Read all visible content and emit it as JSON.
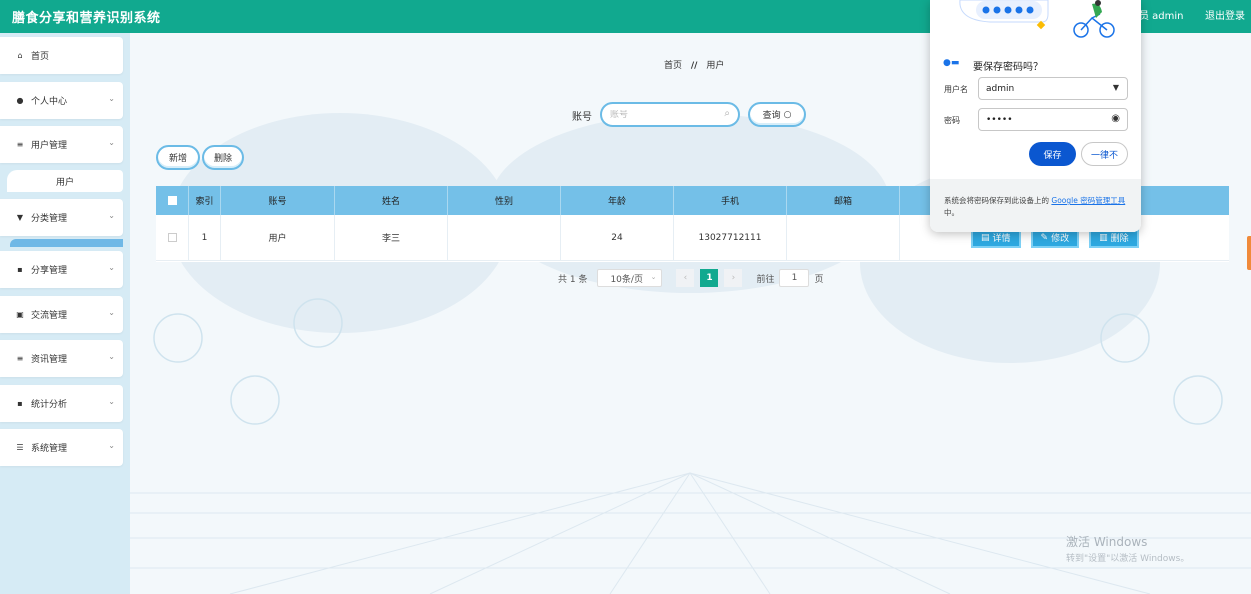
{
  "header": {
    "title": "膳食分享和营养识别系统",
    "user": "员 admin",
    "logout": "退出登录"
  },
  "sidebar": {
    "items": [
      {
        "label": "首页",
        "icon": "home-icon"
      },
      {
        "label": "个人中心",
        "icon": "person-icon"
      },
      {
        "label": "用户管理",
        "icon": "list-icon"
      },
      {
        "label": "分类管理",
        "icon": "category-icon"
      },
      {
        "label": "分享管理",
        "icon": "grid-icon"
      },
      {
        "label": "交流管理",
        "icon": "clipboard-icon"
      },
      {
        "label": "资讯管理",
        "icon": "list-icon"
      },
      {
        "label": "统计分析",
        "icon": "grid-icon"
      },
      {
        "label": "系统管理",
        "icon": "settings-icon"
      }
    ],
    "submenu": {
      "label": "用户"
    }
  },
  "breadcrumb": {
    "home": "首页",
    "separator": "//",
    "current": "用户"
  },
  "search": {
    "label": "账号",
    "placeholder": "账号",
    "button": "查询"
  },
  "toolbar": {
    "add": "新增",
    "delete": "删除"
  },
  "table": {
    "columns": [
      "索引",
      "账号",
      "姓名",
      "性别",
      "年龄",
      "手机",
      "邮箱"
    ],
    "rows": [
      {
        "index": "1",
        "account": "用户",
        "name": "李三",
        "gender": "",
        "age": "24",
        "phone": "13027712111",
        "email": ""
      }
    ],
    "actions": {
      "detail": "详情",
      "edit": "修改",
      "delete": "删除"
    }
  },
  "pagination": {
    "total": "共 1 条",
    "page_size": "10条/页",
    "current": "1",
    "goto_label": "前往",
    "goto_value": "1",
    "page_suffix": "页"
  },
  "password_popup": {
    "title": "要保存密码吗？",
    "username_label": "用户名",
    "username_value": "admin",
    "password_label": "密码",
    "password_value": "•••••",
    "save": "保存",
    "never": "一律不",
    "footer_pre": "系统会将密码保存到此设备上的 ",
    "footer_link": "Google 密码管理工具",
    "footer_post": "中。"
  },
  "watermark": {
    "line1": "激活 Windows",
    "line2": "转到\"设置\"以激活 Windows。"
  },
  "colors": {
    "header": "#11a98f",
    "sidebar_bg": "#d6ebf5",
    "table_header": "#74c0e8",
    "action_button": "#2ea8e0",
    "save_button": "#0b57d0"
  }
}
